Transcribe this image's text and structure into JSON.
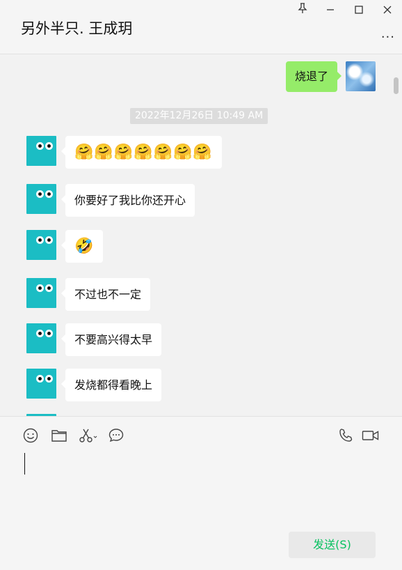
{
  "header": {
    "title": "另外半只. 王成玥",
    "more": "..."
  },
  "chat": {
    "outgoing": {
      "text": "烧退了"
    },
    "timestamp": "2022年12月26日 10:49 AM",
    "incoming": [
      {
        "text": "🤗🤗🤗🤗🤗🤗🤗",
        "is_emoji": true
      },
      {
        "text": "你要好了我比你还开心",
        "is_emoji": false
      },
      {
        "text": "🤣",
        "is_emoji": true
      },
      {
        "text": "不过也不一定",
        "is_emoji": false
      },
      {
        "text": "不要高兴得太早",
        "is_emoji": false
      },
      {
        "text": "发烧都得看晚上",
        "is_emoji": false
      }
    ]
  },
  "toolbar": {
    "icons": [
      "emoji-icon",
      "folder-icon",
      "scissors-icon",
      "chat-history-icon",
      "phone-icon",
      "video-icon"
    ]
  },
  "input": {
    "value": ""
  },
  "send": {
    "label": "发送(S)"
  },
  "colors": {
    "accent": "#07c160",
    "outgoing_bubble": "#95ec69",
    "avatar": "#1bbdc4"
  }
}
